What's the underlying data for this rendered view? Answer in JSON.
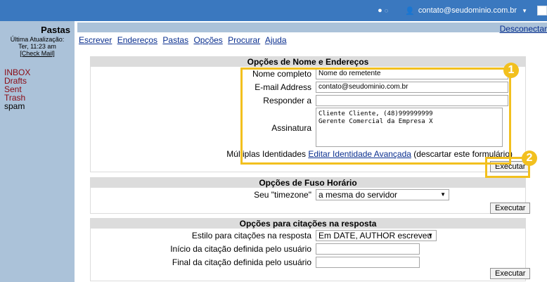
{
  "topbar": {
    "status_icon": "status-dots-icon",
    "user_icon": "user-icon",
    "user_email": "contato@seudominio.com.br"
  },
  "sidebar": {
    "title": "Pastas",
    "last_update_label": "Última Atualização:",
    "last_update_time": "Ter, 11:23 am",
    "check_mail": "[Check Mail]",
    "folders": [
      "INBOX",
      "Drafts",
      "Sent",
      "Trash",
      "spam"
    ]
  },
  "header": {
    "disconnect": "Desconectar"
  },
  "menu": [
    "Escrever",
    "Endereços",
    "Pastas",
    "Opções",
    "Procurar",
    "Ajuda"
  ],
  "name_section": {
    "title": "Opções de Nome e Endereços",
    "full_name_label": "Nome completo",
    "full_name_value": "Nome do remetente",
    "email_label": "E-mail Address",
    "email_value": "contato@seudominio.com.br",
    "reply_label": "Responder a",
    "reply_value": "",
    "signature_label": "Assinatura",
    "signature_value": "Cliente Cliente, (48)999999999\nGerente Comercial da Empresa X",
    "identities_label": "Múltiplas Identidades",
    "identities_link": "Editar Identidade Avançada",
    "identities_note": "(descartar este formulário)",
    "execute": "Executar"
  },
  "tz_section": {
    "title": "Opções de Fuso Horário",
    "timezone_label": "Seu \"timezone\"",
    "timezone_value": "a mesma do servidor",
    "execute": "Executar"
  },
  "reply_section": {
    "title": "Opções para citações na resposta",
    "style_label": "Estilo para citações na resposta",
    "style_value": "Em DATE, AUTHOR escreveu",
    "start_label": "Início da citação definida pelo usuário",
    "start_value": "",
    "end_label": "Final da citação definida pelo usuário",
    "end_value": "",
    "execute": "Executar"
  },
  "annotations": {
    "badge1": "1",
    "badge2": "2",
    "color": "#f2c01e"
  }
}
